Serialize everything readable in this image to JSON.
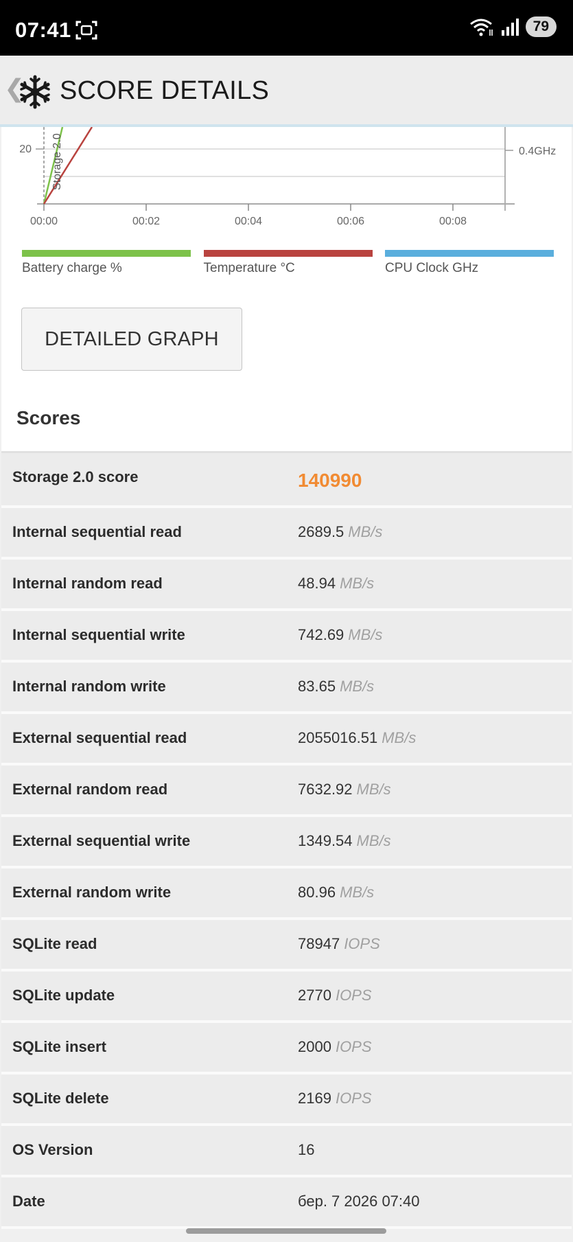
{
  "status_bar": {
    "time": "07:41",
    "battery": "79",
    "icons": [
      "screenshot-icon",
      "wifi-icon",
      "signal-icon",
      "battery-icon"
    ]
  },
  "header": {
    "back_icon": "chevron-left-icon",
    "logo_icon": "snowflake-logo-icon",
    "title": "SCORE DETAILS"
  },
  "chart_data": {
    "type": "line",
    "x_ticks": [
      "00:00",
      "00:02",
      "00:04",
      "00:06",
      "00:08"
    ],
    "y_left_ticks": [
      "20"
    ],
    "y_right_ticks": [
      "0.4GHz"
    ],
    "annotation": "Storage 2.0",
    "series": [
      {
        "name": "Battery charge %",
        "color": "#7dc24a"
      },
      {
        "name": "Temperature °C",
        "color": "#b9433f"
      },
      {
        "name": "CPU Clock GHz",
        "color": "#5aaedd"
      }
    ]
  },
  "legend": [
    {
      "label": "Battery charge %",
      "color": "#7dc24a"
    },
    {
      "label": "Temperature °C",
      "color": "#b9433f"
    },
    {
      "label": "CPU Clock GHz",
      "color": "#5aaedd"
    }
  ],
  "detailed_graph_label": "DETAILED GRAPH",
  "scores_heading": "Scores",
  "scores": [
    {
      "label": "Storage 2.0 score",
      "value": "140990",
      "unit": ""
    },
    {
      "label": "Internal sequential read",
      "value": "2689.5",
      "unit": "MB/s"
    },
    {
      "label": "Internal random read",
      "value": "48.94",
      "unit": "MB/s"
    },
    {
      "label": "Internal sequential write",
      "value": "742.69",
      "unit": "MB/s"
    },
    {
      "label": "Internal random write",
      "value": "83.65",
      "unit": "MB/s"
    },
    {
      "label": "External sequential read",
      "value": "2055016.51",
      "unit": "MB/s"
    },
    {
      "label": "External random read",
      "value": "7632.92",
      "unit": "MB/s"
    },
    {
      "label": "External sequential write",
      "value": "1349.54",
      "unit": "MB/s"
    },
    {
      "label": "External random write",
      "value": "80.96",
      "unit": "MB/s"
    },
    {
      "label": "SQLite read",
      "value": "78947",
      "unit": "IOPS"
    },
    {
      "label": "SQLite update",
      "value": "2770",
      "unit": "IOPS"
    },
    {
      "label": "SQLite insert",
      "value": "2000",
      "unit": "IOPS"
    },
    {
      "label": "SQLite delete",
      "value": "2169",
      "unit": "IOPS"
    },
    {
      "label": "OS Version",
      "value": "16",
      "unit": ""
    },
    {
      "label": "Date",
      "value": "бер. 7 2026 07:40",
      "unit": ""
    }
  ],
  "colors": {
    "score_accent": "#f18b33",
    "header_bg": "#ededed",
    "status_bg": "#000000"
  }
}
